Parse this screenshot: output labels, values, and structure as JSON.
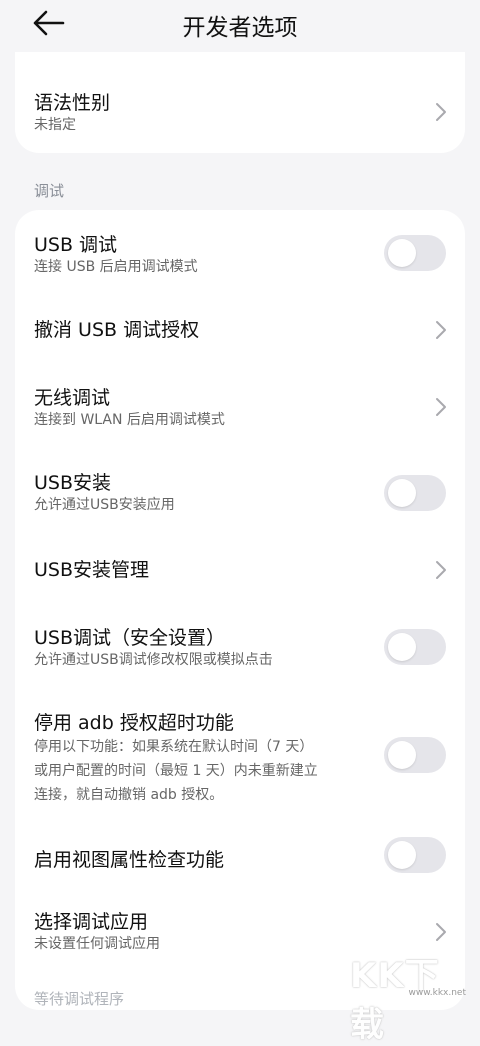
{
  "header": {
    "title": "开发者选项",
    "back_icon": "arrow-left-icon"
  },
  "grammar": {
    "label": "语法性别",
    "value": "未指定"
  },
  "section_debug": "调试",
  "rows": {
    "usb_debug": {
      "label": "USB 调试",
      "sub": "连接 USB 后启用调试模式",
      "checked": false
    },
    "revoke_usb": {
      "label": "撤消 USB 调试授权"
    },
    "wireless_debug": {
      "label": "无线调试",
      "sub": "连接到 WLAN 后启用调试模式"
    },
    "usb_install": {
      "label": "USB安装",
      "sub": "允许通过USB安装应用",
      "checked": false
    },
    "usb_install_mgmt": {
      "label": "USB安装管理"
    },
    "usb_debug_secure": {
      "label": "USB调试（安全设置）",
      "sub": "允许通过USB调试修改权限或模拟点击",
      "checked": false
    },
    "adb_timeout": {
      "label": "停用 adb 授权超时功能",
      "sub1": "停用以下功能：如果系统在默认时间（7 天）",
      "sub2": "或用户配置的时间（最短 1 天）内未重新建立",
      "sub3": "连接，就自动撤销 adb 授权。",
      "checked": false
    },
    "view_attr": {
      "label": "启用视图属性检查功能",
      "checked": false
    },
    "select_debug_app": {
      "label": "选择调试应用",
      "sub": "未设置任何调试应用"
    }
  },
  "section_next": "等待调试程序",
  "watermark": {
    "big": "KK下载",
    "small": "www.kkx.net"
  },
  "colors": {
    "background": "#f5f5f7",
    "card": "#ffffff",
    "toggle_off": "#e5e5ea",
    "section_text": "#8a8f98"
  }
}
